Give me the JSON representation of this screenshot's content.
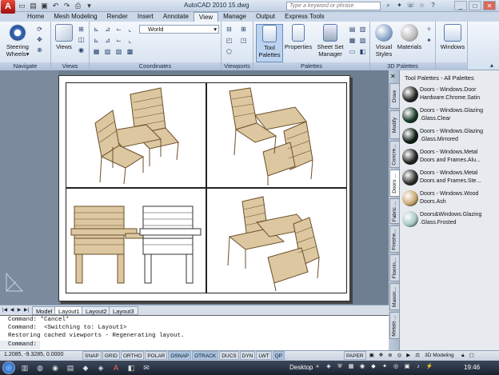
{
  "titlebar": {
    "logo": "A",
    "title": "AutoCAD 2010     15.dwg",
    "search_placeholder": "Type a keyword or phrase",
    "qat_icons": [
      "new-icon",
      "open-icon",
      "save-icon",
      "undo-icon",
      "redo-icon",
      "plot-icon"
    ]
  },
  "tabs": [
    "Home",
    "Mesh Modeling",
    "Render",
    "Insert",
    "Annotate",
    "View",
    "Manage",
    "Output",
    "Express Tools"
  ],
  "active_tab": "View",
  "ribbon": {
    "navigate": {
      "label": "Navigate",
      "steering": "Steering Wheels",
      "steering_arrow": "▾"
    },
    "views": {
      "label": "Views",
      "views_btn": "Views"
    },
    "coordinates": {
      "label": "Coordinates",
      "world": "World"
    },
    "viewports": {
      "label": "Viewports"
    },
    "palettes": {
      "label": "Palettes",
      "tool_palettes": "Tool Palettes",
      "properties": "Properties",
      "sheet_set": "Sheet Set Manager"
    },
    "palettes3d": {
      "label": "3D Palettes",
      "visual_styles": "Visual Styles",
      "materials": "Materials"
    },
    "windows": {
      "label": "",
      "windows_btn": "Windows"
    }
  },
  "palette": {
    "title": "Tool Palettes - All Palettes",
    "tabs": [
      "Draw",
      "Modify",
      "Concre...",
      "Doors ...",
      "Fabric ...",
      "Finishe...",
      "Floorin...",
      "Mason...",
      "Metals ..."
    ],
    "active_tab": "Doors ...",
    "items": [
      {
        "line1": "Doors - Windows.Door",
        "line2": "Hardware.Chrome.Satin",
        "color": "#2b2b2b"
      },
      {
        "line1": "Doors - Windows.Glazing",
        "line2": ".Glass.Clear",
        "color": "#1e3d2a"
      },
      {
        "line1": "Doors - Windows.Glazing",
        "line2": ".Glass.Mirrored",
        "color": "#0f1f18"
      },
      {
        "line1": "Doors - Windows.Metal",
        "line2": "Doors and Frames.Alu...",
        "color": "#262626"
      },
      {
        "line1": "Doors - Windows.Metal",
        "line2": "Doors and Frames.Ste...",
        "color": "#303030"
      },
      {
        "line1": "Doors - Windows.Wood",
        "line2": "Doors.Ash",
        "color": "#c9a874"
      },
      {
        "line1": "Doors&Windows.Glazing",
        "line2": ".Glass.Frosted",
        "color": "#a8c8c8"
      }
    ]
  },
  "layout_tabs": [
    "Model",
    "Layout1",
    "Layout2",
    "Layout3"
  ],
  "active_layout": "Layout1",
  "command": {
    "lines": [
      "Command: *Cancel*",
      "Command:  <Switching to: Layout1>",
      "Restoring cached viewports - Regenerating layout."
    ],
    "prompt": "Command:"
  },
  "status": {
    "coords": "1.2085, -9.3285, 0.0000",
    "toggles": [
      "SNAP",
      "GRID",
      "ORTHO",
      "POLAR",
      "OSNAP",
      "OTRACK",
      "DUCS",
      "DYN",
      "LWT",
      "QP"
    ],
    "toggles_on": [
      "OSNAP",
      "OTRACK",
      "QP"
    ],
    "paper": "PAPER",
    "workspace": "3D Modeling"
  },
  "taskbar": {
    "desktop": "Desktop",
    "clock": "19:46"
  },
  "colors": {
    "accent": "#a8c4e4",
    "wood": "#d9c4a0",
    "wood_dark": "#8a6a3e"
  }
}
